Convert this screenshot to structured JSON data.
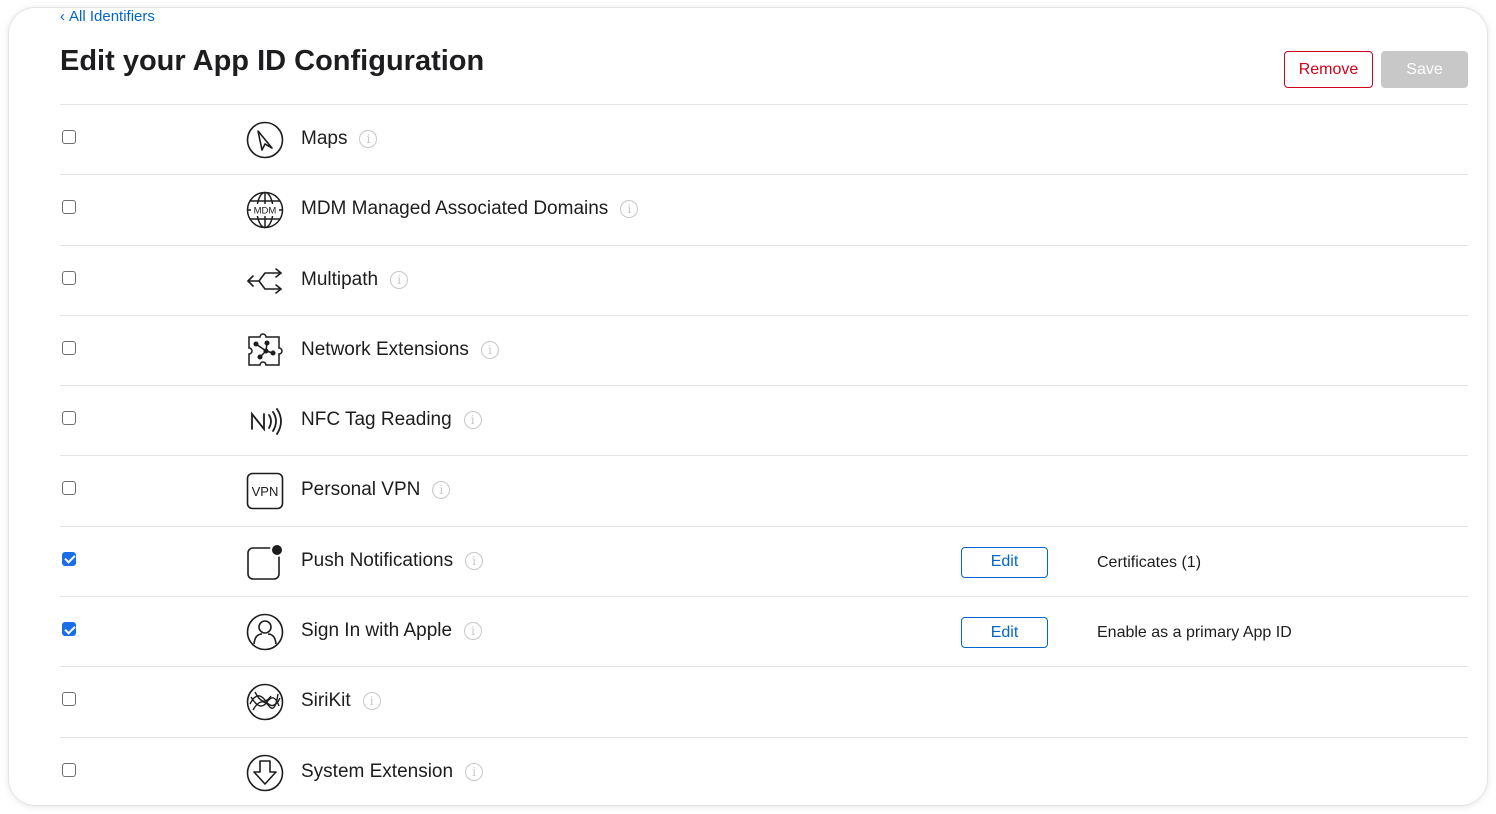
{
  "header": {
    "back_link": "All Identifiers",
    "title": "Edit your App ID Configuration",
    "remove_label": "Remove",
    "save_label": "Save"
  },
  "capabilities": [
    {
      "label": "Maps",
      "checked": false,
      "icon": "maps-icon"
    },
    {
      "label": "MDM Managed Associated Domains",
      "checked": false,
      "icon": "mdm-globe-icon"
    },
    {
      "label": "Multipath",
      "checked": false,
      "icon": "multipath-arrows-icon"
    },
    {
      "label": "Network Extensions",
      "checked": false,
      "icon": "network-puzzle-icon"
    },
    {
      "label": "NFC Tag Reading",
      "checked": false,
      "icon": "nfc-icon"
    },
    {
      "label": "Personal VPN",
      "checked": false,
      "icon": "vpn-icon"
    },
    {
      "label": "Push Notifications",
      "checked": true,
      "icon": "notification-badge-icon",
      "edit_label": "Edit",
      "note": "Certificates (1)"
    },
    {
      "label": "Sign In with Apple",
      "checked": true,
      "icon": "person-circle-icon",
      "edit_label": "Edit",
      "note": "Enable as a primary App ID"
    },
    {
      "label": "SiriKit",
      "checked": false,
      "icon": "siri-icon"
    },
    {
      "label": "System Extension",
      "checked": false,
      "icon": "system-extension-icon"
    }
  ],
  "colors": {
    "link": "#0066cc",
    "remove": "#d0021b",
    "save_disabled": "#c8c8c8",
    "checkbox_checked": "#1a6fe8"
  }
}
